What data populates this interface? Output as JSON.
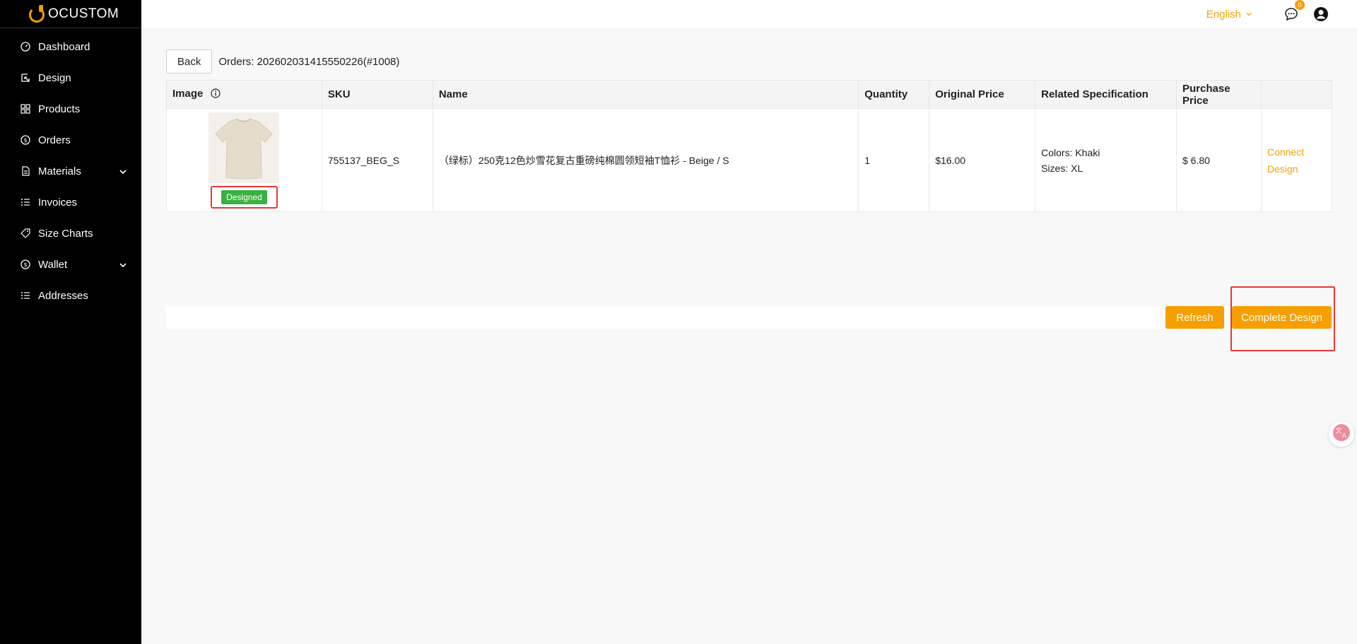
{
  "brand": {
    "logo_text": "OCUSTOM"
  },
  "colors": {
    "accent": "#f5a000",
    "sidebar_bg": "#000000",
    "designed_tag": "#3cb043",
    "highlight": "#e53935"
  },
  "sidebar": {
    "items": [
      {
        "label": "Dashboard",
        "icon": "dashboard-icon"
      },
      {
        "label": "Design",
        "icon": "design-icon"
      },
      {
        "label": "Products",
        "icon": "products-icon"
      },
      {
        "label": "Orders",
        "icon": "orders-icon"
      },
      {
        "label": "Materials",
        "icon": "materials-icon",
        "expandable": true
      },
      {
        "label": "Invoices",
        "icon": "list-icon"
      },
      {
        "label": "Size Charts",
        "icon": "tag-icon"
      },
      {
        "label": "Wallet",
        "icon": "wallet-icon",
        "expandable": true
      },
      {
        "label": "Addresses",
        "icon": "list-icon"
      }
    ]
  },
  "topbar": {
    "language": "English",
    "message_count": "0"
  },
  "order": {
    "back_label": "Back",
    "title": "Orders: 202602031415550226(#1008)"
  },
  "table": {
    "headers": [
      "Image",
      "SKU",
      "Name",
      "Quantity",
      "Original Price",
      "Related Specification",
      "Purchase Price",
      ""
    ],
    "rows": [
      {
        "status": "Designed",
        "sku": "755137_BEG_S",
        "name": "（绿标）250克12色炒雪花复古重磅纯棉圆领短袖T恤衫 - Beige / S",
        "quantity": "1",
        "original_price": "$16.00",
        "spec_colors": "Colors: Khaki",
        "spec_sizes": "Sizes: XL",
        "purchase_price": "$ 6.80",
        "action_line1": "Connect",
        "action_line2": "Design"
      }
    ]
  },
  "actions": {
    "refresh_label": "Refresh",
    "complete_label": "Complete Design"
  }
}
